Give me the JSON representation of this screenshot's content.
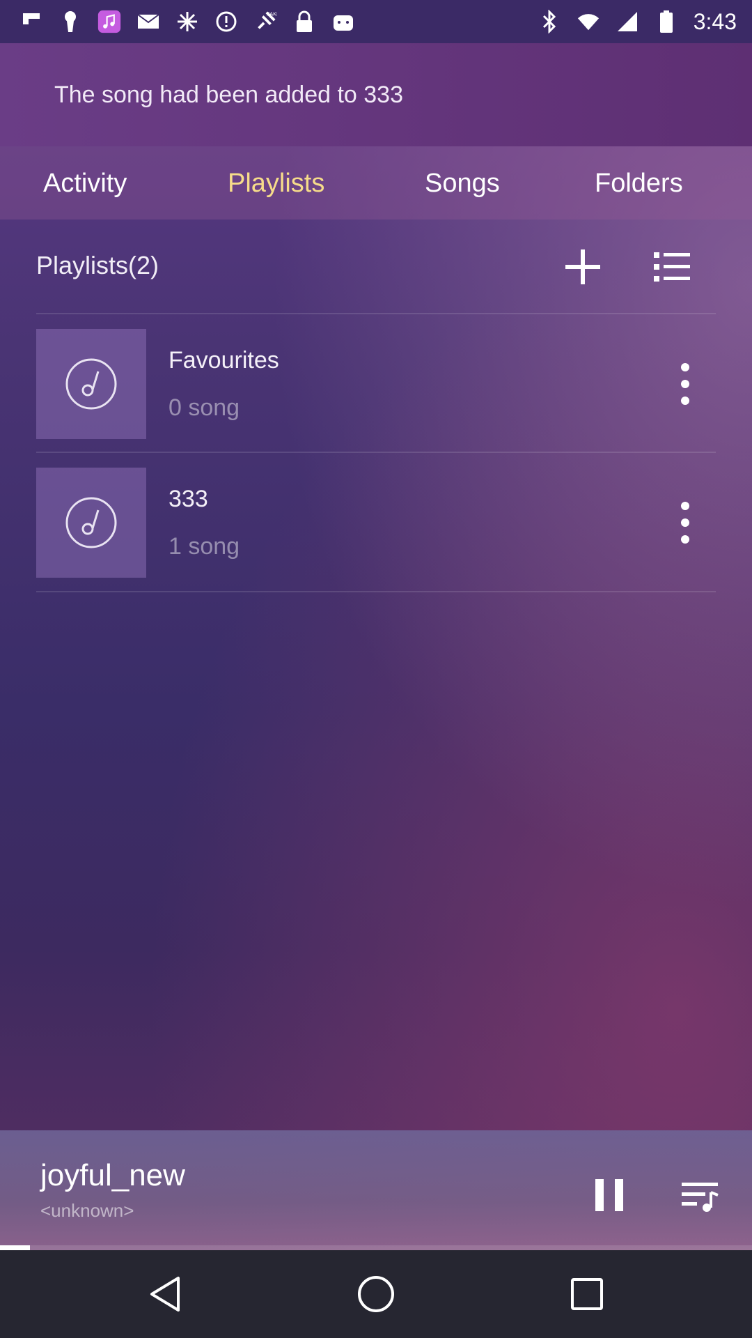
{
  "status_bar": {
    "time": "3:43",
    "left_icons": [
      "flipboard-icon",
      "keyhole-icon",
      "music-app-icon",
      "mail-icon",
      "settings-burst-icon",
      "alert-icon",
      "fake-gps-icon",
      "lock-icon",
      "android-icon"
    ],
    "right_icons": [
      "bluetooth-icon",
      "wifi-icon",
      "signal-icon",
      "battery-icon"
    ]
  },
  "snackbar": {
    "message": "The song had been added to 333"
  },
  "tabs": [
    {
      "label": "Activity",
      "active": false
    },
    {
      "label": "Playlists",
      "active": true
    },
    {
      "label": "Songs",
      "active": false
    },
    {
      "label": "Folders",
      "active": false
    }
  ],
  "playlists_header": {
    "title": "Playlists(2)",
    "add_icon": "plus-icon",
    "menu_icon": "list-icon"
  },
  "playlists": [
    {
      "name": "Favourites",
      "count": "0 song"
    },
    {
      "name": "333",
      "count": "1 song"
    }
  ],
  "now_playing": {
    "title": "joyful_new",
    "artist": "<unknown>",
    "progress": 0.04
  },
  "colors": {
    "active_tab": "#f6dc8a",
    "nav_bar": "#262631"
  }
}
